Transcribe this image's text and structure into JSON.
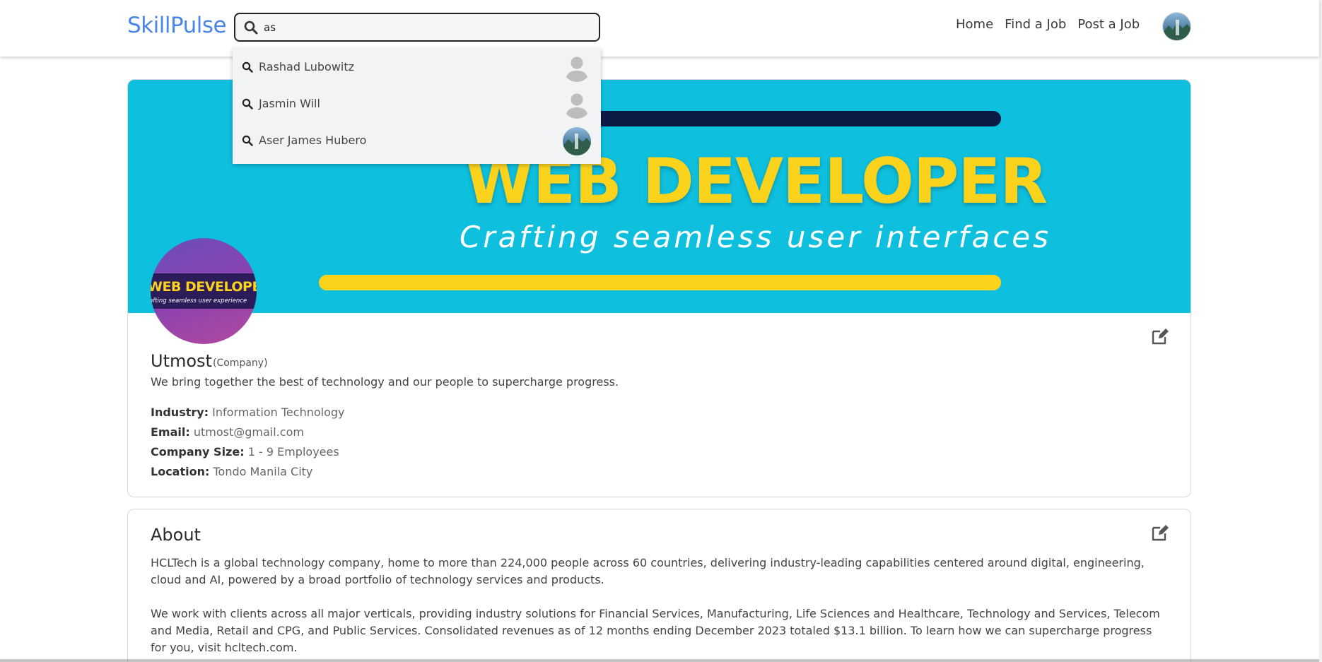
{
  "navbar": {
    "brand": "SkillPulse",
    "search_value": "as",
    "links": [
      "Home",
      "Find a Job",
      "Post a Job"
    ],
    "avatar_icon": "user-avatar-icon"
  },
  "search_dropdown": {
    "items": [
      {
        "name": "Rashad Lubowitz",
        "avatar": "default-avatar-icon"
      },
      {
        "name": "Jasmin Will",
        "avatar": "default-avatar-icon"
      },
      {
        "name": "Aser James Hubero",
        "avatar": "photo-avatar-icon"
      }
    ]
  },
  "profile": {
    "banner_title": "WEB DEVELOPER",
    "banner_subtitle": "Crafting seamless user interfaces",
    "logo_title": "WEB DEVELOPER",
    "logo_subtitle": "afting seamless user experience",
    "name": "Utmost",
    "type": "(Company)",
    "tagline": "We bring together the best of technology and our people to supercharge progress.",
    "details": [
      {
        "label": "Industry:",
        "value": "Information Technology"
      },
      {
        "label": "Email:",
        "value": "utmost@gmail.com"
      },
      {
        "label": "Company Size:",
        "value": "1 - 9 Employees"
      },
      {
        "label": "Location:",
        "value": "Tondo Manila City"
      }
    ]
  },
  "about": {
    "title": "About",
    "paragraphs": [
      "HCLTech is a global technology company, home to more than 224,000 people across 60 countries, delivering industry-leading capabilities centered around digital, engineering, cloud and AI, powered by a broad portfolio of technology services and products.",
      "We work with clients across all major verticals, providing industry solutions for Financial Services, Manufacturing, Life Sciences and Healthcare, Technology and Services, Telecom and Media, Retail and CPG, and Public Services. Consolidated revenues as of 12 months ending December 2023 totaled $13.1 billion. To learn how we can supercharge progress for you, visit hcltech.com."
    ]
  },
  "colors": {
    "brand": "#4a86e8",
    "banner_bg": "#0ec0de",
    "banner_yellow": "#fbd21c",
    "banner_dark": "#0a1a44"
  }
}
